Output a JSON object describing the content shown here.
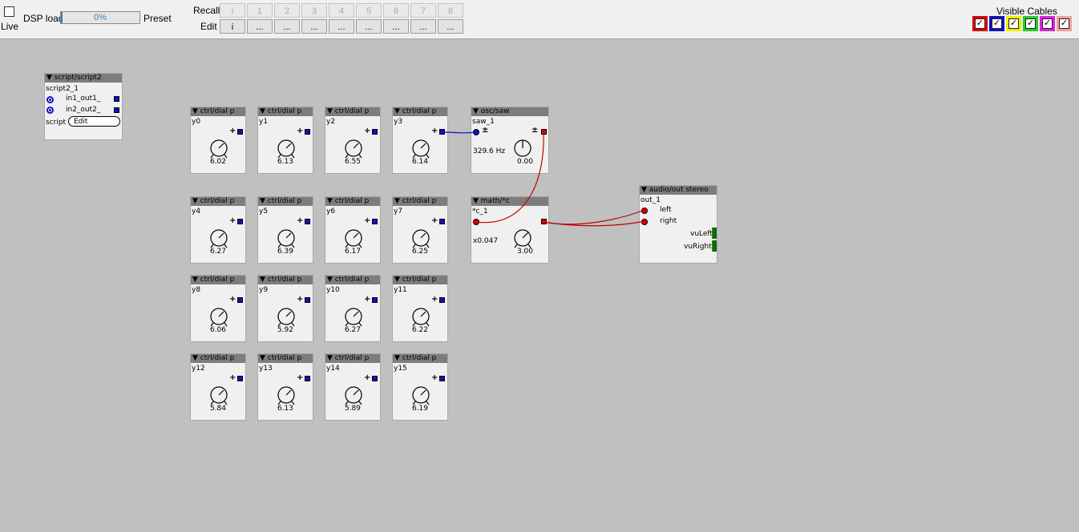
{
  "toolbar": {
    "live_label": "Live",
    "dsp_label": "DSP load",
    "dsp_value": "0%",
    "dsp_fraction": 0.0,
    "preset_label": "Preset",
    "recall_label": "Recall",
    "edit_label": "Edit",
    "recall_buttons": [
      "i",
      "1",
      "2",
      "3",
      "4",
      "5",
      "6",
      "7",
      "8"
    ],
    "edit_buttons": [
      "i",
      "...",
      "...",
      "...",
      "...",
      "...",
      "...",
      "...",
      "..."
    ],
    "visible_cables_label": "Visible Cables",
    "cable_colors": [
      {
        "color": "#e00000",
        "check": "✓"
      },
      {
        "color": "#1010d0",
        "check": "✓"
      },
      {
        "color": "#f0f000",
        "check": "✓"
      },
      {
        "color": "#20d020",
        "check": "✓"
      },
      {
        "color": "#e020e0",
        "check": "✓"
      },
      {
        "color": "#f0a0a0",
        "check": "✓"
      }
    ]
  },
  "script": {
    "header": "▼ script/script2",
    "instance": "script2_1",
    "in1": "in1_out1_",
    "in2": "in2_out2_",
    "param_label": "script",
    "edit_label": "Edit"
  },
  "dials": [
    {
      "header": "▼ ctrl/dial p",
      "name": "y0",
      "value": "6.02"
    },
    {
      "header": "▼ ctrl/dial p",
      "name": "y1",
      "value": "6.13"
    },
    {
      "header": "▼ ctrl/dial p",
      "name": "y2",
      "value": "6.55"
    },
    {
      "header": "▼ ctrl/dial p",
      "name": "y3",
      "value": "6.14"
    },
    {
      "header": "▼ ctrl/dial p",
      "name": "y4",
      "value": "6.27"
    },
    {
      "header": "▼ ctrl/dial p",
      "name": "y5",
      "value": "6.39"
    },
    {
      "header": "▼ ctrl/dial p",
      "name": "y6",
      "value": "6.17"
    },
    {
      "header": "▼ ctrl/dial p",
      "name": "y7",
      "value": "6.25"
    },
    {
      "header": "▼ ctrl/dial p",
      "name": "y8",
      "value": "6.06"
    },
    {
      "header": "▼ ctrl/dial p",
      "name": "y9",
      "value": "5.92"
    },
    {
      "header": "▼ ctrl/dial p",
      "name": "y10",
      "value": "6.27"
    },
    {
      "header": "▼ ctrl/dial p",
      "name": "y11",
      "value": "6.22"
    },
    {
      "header": "▼ ctrl/dial p",
      "name": "y12",
      "value": "5.84"
    },
    {
      "header": "▼ ctrl/dial p",
      "name": "y13",
      "value": "6.13"
    },
    {
      "header": "▼ ctrl/dial p",
      "name": "y14",
      "value": "5.89"
    },
    {
      "header": "▼ ctrl/dial p",
      "name": "y15",
      "value": "6.19"
    }
  ],
  "saw": {
    "header": "▼ osc/saw",
    "instance": "saw_1",
    "pm": "±",
    "freq": "329.6 Hz",
    "value": "0.00"
  },
  "mult": {
    "header": "▼ math/*c",
    "instance": "*c_1",
    "factor": "x0.047",
    "value": "3.00"
  },
  "out": {
    "header": "▼ audio/out stereo",
    "instance": "out_1",
    "left": "left",
    "right": "right",
    "vu_left": "vuLeft",
    "vu_right": "vuRight"
  }
}
